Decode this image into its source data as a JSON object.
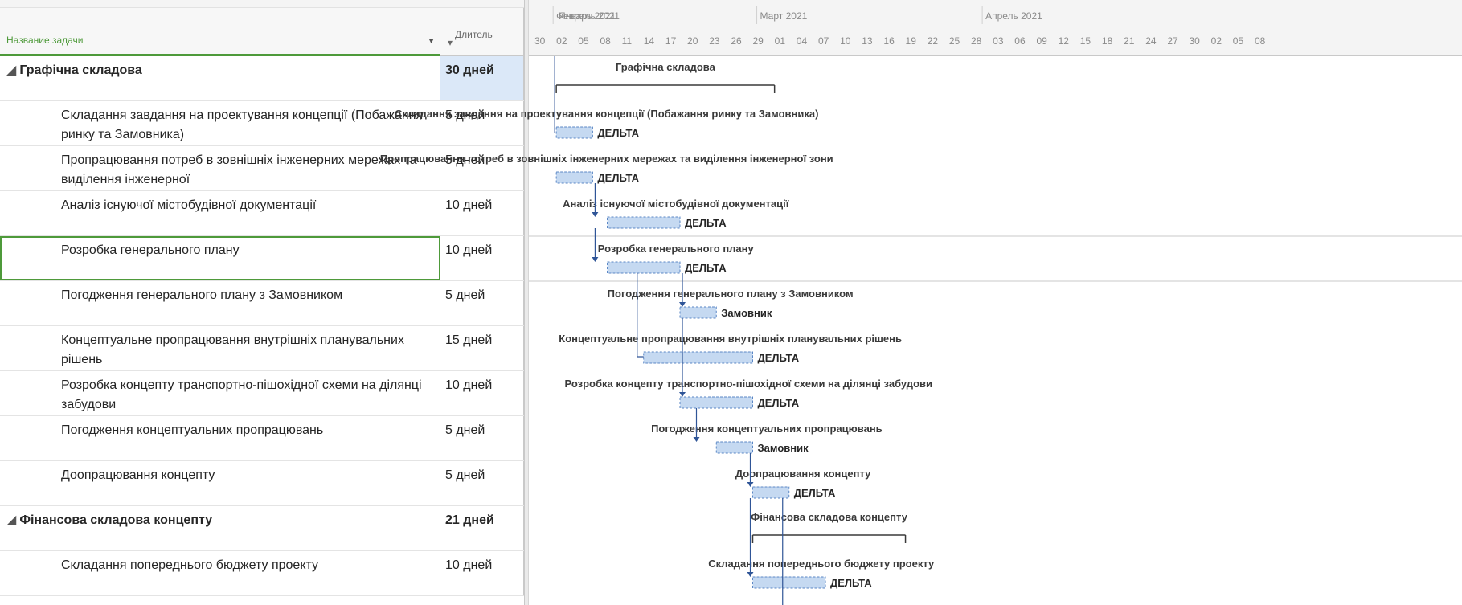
{
  "grid": {
    "header": {
      "name_label": "Название задачи",
      "duration_label": "Длитель"
    },
    "rows": [
      {
        "name": "Графічна складова",
        "duration": "30 дней",
        "summary": true
      },
      {
        "name": "Складання завдання на проектування концепції (Побажання ринку та Замовника)",
        "duration": "5 дней",
        "summary": false
      },
      {
        "name": "Пропрацювання потреб в зовнішніх інженерних мережах та виділення інженерної",
        "duration": "5 дней",
        "summary": false
      },
      {
        "name": "Аналіз існуючої містобудівної документації",
        "duration": "10 дней",
        "summary": false
      },
      {
        "name": "Розробка генерального плану",
        "duration": "10 дней",
        "summary": false
      },
      {
        "name": "Погодження генерального плану з Замовником",
        "duration": "5 дней",
        "summary": false
      },
      {
        "name": "Концептуальне пропрацювання внутрішніх планувальних рішень",
        "duration": "15 дней",
        "summary": false
      },
      {
        "name": "Розробка концепту транспортно-пішохідної схеми на ділянці забудови",
        "duration": "10 дней",
        "summary": false
      },
      {
        "name": "Погодження концептуальних пропрацювань",
        "duration": "5 дней",
        "summary": false
      },
      {
        "name": "Доопрацювання концепту",
        "duration": "5 дней",
        "summary": false
      },
      {
        "name": "Фінансова складова концепту",
        "duration": "21 дней",
        "summary": true
      },
      {
        "name": "Складання попереднього бюджету проекту",
        "duration": "10 дней",
        "summary": false
      }
    ]
  },
  "timescale": {
    "months": [
      "Январь 2021",
      "Февраль 2021",
      "Март 2021",
      "Апрель 2021"
    ],
    "days": [
      "30",
      "02",
      "05",
      "08",
      "11",
      "14",
      "17",
      "20",
      "23",
      "26",
      "29",
      "01",
      "04",
      "07",
      "10",
      "13",
      "16",
      "19",
      "22",
      "25",
      "28",
      "03",
      "06",
      "09",
      "12",
      "15",
      "18",
      "21",
      "24",
      "27",
      "30",
      "02",
      "05",
      "08"
    ]
  },
  "gantt": {
    "bars": [
      {
        "label": "Графічна складова",
        "resource": "",
        "summary": true,
        "start": "01.02",
        "end": "02.03"
      },
      {
        "label": "Складання завдання на проектування концепції (Побажання ринку та Замовника)",
        "resource": "ДЕЛЬТА",
        "summary": false,
        "start": "01.02",
        "end": "05.02"
      },
      {
        "label": "Пропрацювання потреб в зовнішніх інженерних мережах та виділення інженерної зони",
        "resource": "ДЕЛЬТА",
        "summary": false,
        "start": "01.02",
        "end": "05.02"
      },
      {
        "label": "Аналіз існуючої містобудівної документації",
        "resource": "ДЕЛЬТА",
        "summary": false,
        "start": "08.02",
        "end": "17.02"
      },
      {
        "label": "Розробка генерального плану",
        "resource": "ДЕЛЬТА",
        "summary": false,
        "start": "08.02",
        "end": "17.02"
      },
      {
        "label": "Погодження генерального плану з Замовником",
        "resource": "Замовник",
        "summary": false,
        "start": "18.02",
        "end": "22.02"
      },
      {
        "label": "Концептуальне пропрацювання внутрішніх планувальних рішень",
        "resource": "ДЕЛЬТА",
        "summary": false,
        "start": "13.02",
        "end": "27.02"
      },
      {
        "label": "Розробка концепту транспортно-пішохідної схеми на ділянці забудови",
        "resource": "ДЕЛЬТА",
        "summary": false,
        "start": "18.02",
        "end": "27.02"
      },
      {
        "label": "Погодження концептуальних пропрацювань",
        "resource": "Замовник",
        "summary": false,
        "start": "23.02",
        "end": "27.02"
      },
      {
        "label": "Доопрацювання концепту",
        "resource": "ДЕЛЬТА",
        "summary": false,
        "start": "28.02",
        "end": "04.03"
      },
      {
        "label": "Фінансова складова концепту",
        "resource": "",
        "summary": true,
        "start": "28.02",
        "end": "20.03"
      },
      {
        "label": "Складання попереднього бюджету проекту",
        "resource": "ДЕЛЬТА",
        "summary": false,
        "start": "28.02",
        "end": "09.03"
      }
    ]
  },
  "colors": {
    "bar_fill": "#c5d9f1",
    "bar_stroke": "#5b87c5",
    "link": "#2f5597",
    "summary": "#3a3a3a",
    "selection": "#4e9a3a"
  }
}
